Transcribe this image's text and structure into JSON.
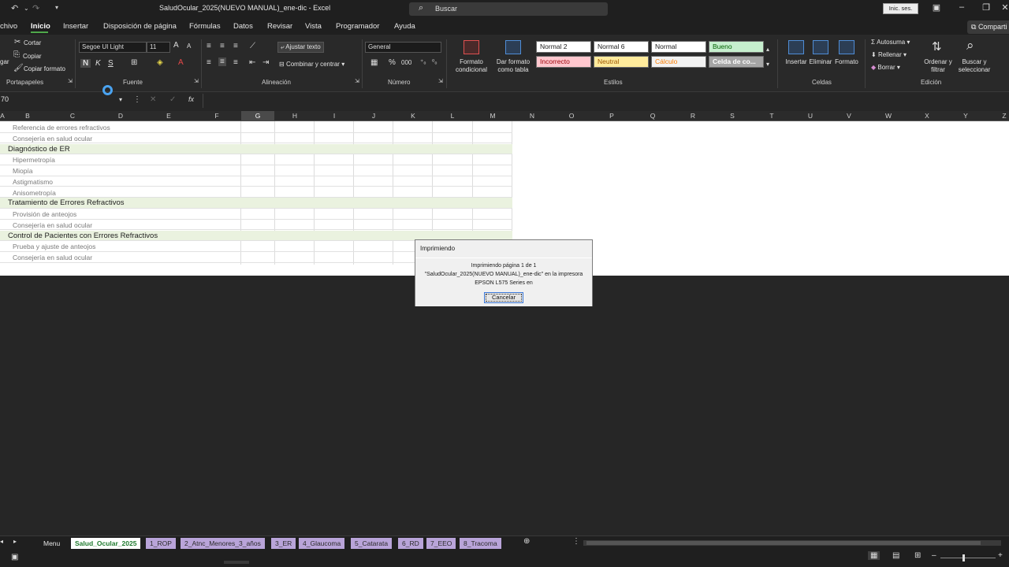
{
  "window": {
    "title": "SaludOcular_2025(NUEVO MANUAL)_ene-dic  -  Excel",
    "search_label": "Buscar",
    "signin_label": "Inic. ses.",
    "share_label": "Comparti"
  },
  "menu": {
    "tabs": [
      "chivo",
      "Inicio",
      "Insertar",
      "Disposición de página",
      "Fórmulas",
      "Datos",
      "Revisar",
      "Vista",
      "Programador",
      "Ayuda"
    ],
    "active": "Inicio"
  },
  "ribbon": {
    "clipboard": {
      "paste_short": "gar",
      "cut": "Cortar",
      "copy": "Copiar",
      "format_painter": "Copiar formato",
      "group": "Portapapeles"
    },
    "font": {
      "name": "Segoe UI Light",
      "size": "11",
      "bold": "N",
      "italic": "K",
      "underline": "S",
      "group": "Fuente"
    },
    "alignment": {
      "wrap": "Ajustar texto",
      "merge": "Combinar y centrar",
      "group": "Alineación"
    },
    "number": {
      "format": "General",
      "percent": "%",
      "group": "Número"
    },
    "styles": {
      "conditional": "Formato condicional",
      "as_table": "Dar formato como tabla",
      "cells": [
        {
          "label": "Normal 2",
          "bg": "#ffffff",
          "fg": "#1a1a1a"
        },
        {
          "label": "Normal 6",
          "bg": "#ffffff",
          "fg": "#1a1a1a"
        },
        {
          "label": "Normal",
          "bg": "#ffffff",
          "fg": "#1a1a1a"
        },
        {
          "label": "Bueno",
          "bg": "#c6efce",
          "fg": "#006100"
        },
        {
          "label": "Incorrecto",
          "bg": "#ffc7ce",
          "fg": "#9c0006"
        },
        {
          "label": "Neutral",
          "bg": "#ffeb9c",
          "fg": "#9c5700"
        },
        {
          "label": "Cálculo",
          "bg": "#f2f2f2",
          "fg": "#fa7d00"
        },
        {
          "label": "Celda de co...",
          "bg": "#a5a5a5",
          "fg": "#ffffff"
        }
      ],
      "group": "Estilos"
    },
    "cells": {
      "insert": "Insertar",
      "delete": "Eliminar",
      "format": "Formato",
      "group": "Celdas"
    },
    "editing": {
      "autosum": "Autosuma",
      "fill": "Rellenar",
      "clear": "Borrar",
      "sort": "Ordenar y filtrar",
      "find": "Buscar y seleccionar",
      "group": "Edición"
    }
  },
  "formula_bar": {
    "name_box": "70",
    "fx": "fx"
  },
  "columns": [
    "A",
    "B",
    "C",
    "D",
    "E",
    "F",
    "G",
    "H",
    "I",
    "J",
    "K",
    "L",
    "M",
    "N",
    "O",
    "P",
    "Q",
    "R",
    "S",
    "T",
    "U",
    "V",
    "W",
    "X",
    "Y",
    "Z"
  ],
  "selected_column": "G",
  "rows": [
    {
      "text": "Referencia de errores refractivos",
      "type": "item"
    },
    {
      "text": "Consejería en salud ocular",
      "type": "item"
    },
    {
      "text": "Diagnóstico de ER",
      "type": "head"
    },
    {
      "text": "Hipermetropía",
      "type": "item"
    },
    {
      "text": "Miopía",
      "type": "item"
    },
    {
      "text": "Astigmatismo",
      "type": "item"
    },
    {
      "text": "Anisometropía",
      "type": "item"
    },
    {
      "text": "Tratamiento de Errores Refractivos",
      "type": "head"
    },
    {
      "text": "Provisión de anteojos",
      "type": "item"
    },
    {
      "text": "Consejería en salud ocular",
      "type": "item"
    },
    {
      "text": "Control de Pacientes con Errores Refractivos",
      "type": "head"
    },
    {
      "text": "Prueba y ajuste de anteojos",
      "type": "item"
    },
    {
      "text": "Consejería en salud ocular",
      "type": "item"
    }
  ],
  "dialog": {
    "title": "Imprimiendo",
    "line1": "Imprimiendo página 1 de 1",
    "line2": "\"SaludOcular_2025(NUEVO MANUAL)_ene-dic\" en la impresora",
    "line3": "EPSON L575 Series en",
    "cancel": "Cancelar"
  },
  "sheet_tabs": [
    {
      "label": "Menu",
      "style": "plain"
    },
    {
      "label": "Salud_Ocular_2025",
      "style": "active"
    },
    {
      "label": "1_ROP",
      "style": "purple"
    },
    {
      "label": "2_Atnc_Menores_3_años",
      "style": "purple"
    },
    {
      "label": "3_ER",
      "style": "purple"
    },
    {
      "label": "4_Glaucoma",
      "style": "purple"
    },
    {
      "label": "5_Catarata",
      "style": "purple"
    },
    {
      "label": "6_RD",
      "style": "purple"
    },
    {
      "label": "7_EEO",
      "style": "purple"
    },
    {
      "label": "8_Tracoma",
      "style": "purple"
    }
  ]
}
